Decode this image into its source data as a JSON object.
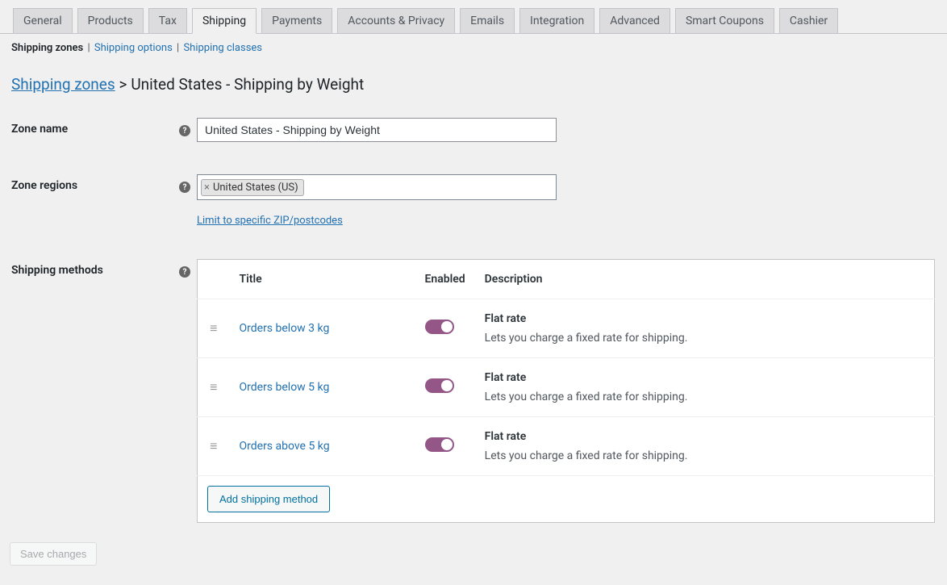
{
  "tabs": [
    "General",
    "Products",
    "Tax",
    "Shipping",
    "Payments",
    "Accounts & Privacy",
    "Emails",
    "Integration",
    "Advanced",
    "Smart Coupons",
    "Cashier"
  ],
  "subnav": {
    "zones": "Shipping zones",
    "options": "Shipping options",
    "classes": "Shipping classes"
  },
  "breadcrumb": {
    "link": "Shipping zones",
    "sep": ">",
    "title": "United States - Shipping by Weight"
  },
  "labels": {
    "zone_name": "Zone name",
    "zone_regions": "Zone regions",
    "shipping_methods": "Shipping methods"
  },
  "zone_name_value": "United States - Shipping by Weight",
  "region_tag": "United States (US)",
  "zip_link": "Limit to specific ZIP/postcodes",
  "columns": {
    "title": "Title",
    "enabled": "Enabled",
    "description": "Description"
  },
  "methods": [
    {
      "title": "Orders below 3 kg",
      "desc_title": "Flat rate",
      "desc_text": "Lets you charge a fixed rate for shipping."
    },
    {
      "title": "Orders below 5 kg",
      "desc_title": "Flat rate",
      "desc_text": "Lets you charge a fixed rate for shipping."
    },
    {
      "title": "Orders above 5 kg",
      "desc_title": "Flat rate",
      "desc_text": "Lets you charge a fixed rate for shipping."
    }
  ],
  "add_method": "Add shipping method",
  "save": "Save changes",
  "help_glyph": "?"
}
